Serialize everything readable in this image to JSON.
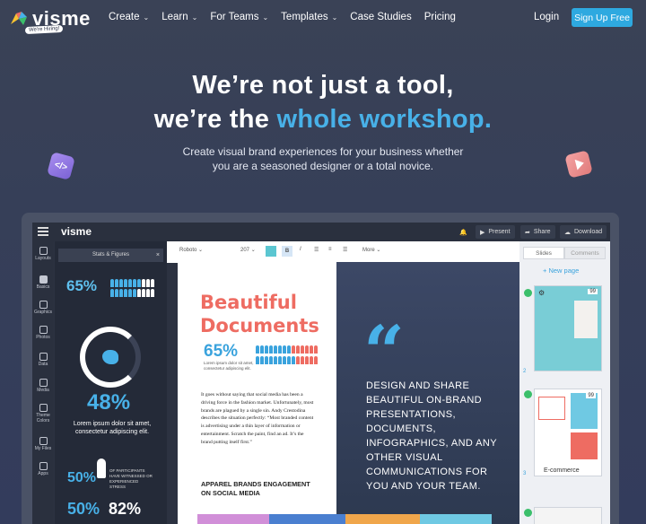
{
  "nav": {
    "logo": "visme",
    "hiring_badge": "We're Hiring!",
    "menu": [
      {
        "label": "Create",
        "dropdown": true
      },
      {
        "label": "Learn",
        "dropdown": true
      },
      {
        "label": "For Teams",
        "dropdown": true
      },
      {
        "label": "Templates",
        "dropdown": true
      },
      {
        "label": "Case Studies",
        "dropdown": false
      },
      {
        "label": "Pricing",
        "dropdown": false
      }
    ],
    "login": "Login",
    "signup": "Sign Up Free"
  },
  "hero": {
    "line1": "We’re not just a tool,",
    "line2_prefix": "we’re the ",
    "line2_accent": "whole workshop.",
    "subtitle_line1": "Create visual brand experiences for your business whether",
    "subtitle_line2": "you are a seasoned designer or a total novice."
  },
  "editor": {
    "logo": "visme",
    "present": "Present",
    "share": "Share",
    "download": "Download",
    "sidebar": [
      "Layouts",
      "Basics",
      "Graphics",
      "Photos",
      "Data",
      "Media",
      "Theme Colors",
      "My Files",
      "Apps"
    ],
    "panel_title": "Stats & Figures",
    "panel_close": "×",
    "panel_stats": {
      "p65": "65%",
      "p48": "48%",
      "lorem": "Lorem ipsum dolor sit amet, consectetur adipiscing elit.",
      "p50a": "50%",
      "stress": "OF PARTICIPANTS HAVE WITNESSED OR EXPERIENCED STRESS",
      "p50b": "50%",
      "p82": "82%"
    },
    "format_bar": {
      "font": "Roboto",
      "size": "207",
      "bold": "B",
      "italic": "I",
      "more": "More"
    },
    "doc": {
      "title_line1": "Beautiful",
      "title_line2": "Documents",
      "stat": "65%",
      "stat_caption": "Lorem ipsum dolor sit amet, consectetur adipiscing elit.",
      "body": "It goes without saying that social media has been a driving force in the fashion market. Unfortunately, most brands are plagued by a single sin. Andy Crestodina describes the situation perfectly: “Most branded content is advertising under a thin layer of information or entertainment. Scratch the paint, find an ad. It’s the brand putting itself first.”",
      "heading_line1": "APPAREL BRANDS ENGAGEMENT",
      "heading_line2": "ON SOCIAL MEDIA"
    },
    "dark_panel": {
      "text": "DESIGN AND SHARE BEAUTIFUL ON-BRAND PRESENTATIONS, DOCUMENTS, INFOGRAPHICS, AND ANY OTHER VISUAL COMMUNICATIONS FOR YOU AND YOUR TEAM."
    },
    "slides_panel": {
      "tab_slides": "Slides",
      "tab_comments": "Comments",
      "new_page": "+ New page",
      "thumb1_badge": "99",
      "thumb2_num": "2",
      "thumb2_badge": "99",
      "thumb3_num": "3",
      "thumb3_label": "E-commerce"
    }
  },
  "colors": {
    "accent_blue": "#48b1e8",
    "signup_blue": "#2ea9e0",
    "coral": "#ee6c62",
    "check_green": "#3bbf6b"
  }
}
